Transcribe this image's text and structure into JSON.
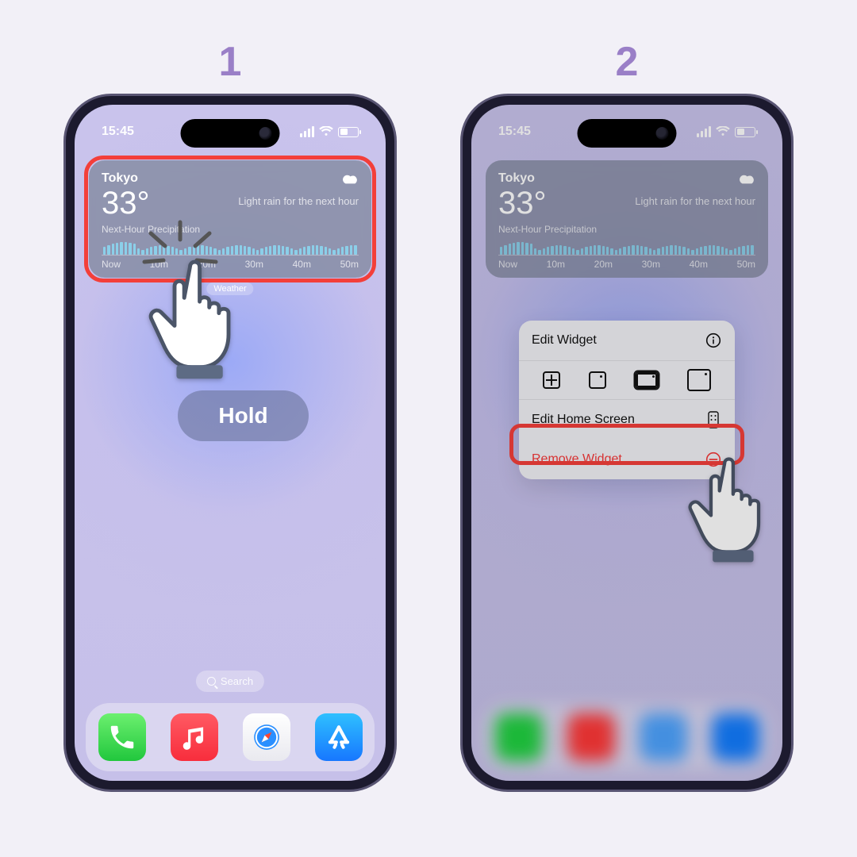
{
  "steps": {
    "one_label": "1",
    "two_label": "2"
  },
  "status": {
    "time": "15:45"
  },
  "widget": {
    "city": "Tokyo",
    "temperature": "33°",
    "condition": "Light rain for the next hour",
    "section_label": "Next-Hour Precipitation",
    "ticks": [
      "Now",
      "10m",
      "20m",
      "30m",
      "40m",
      "50m"
    ],
    "app_label": "Weather"
  },
  "annotations": {
    "hold_label": "Hold"
  },
  "homescreen": {
    "search_label": "Search",
    "dock_apps": [
      "Phone",
      "Music",
      "Safari",
      "App Store"
    ]
  },
  "context_menu": {
    "edit_widget_label": "Edit Widget",
    "edit_home_label": "Edit Home Screen",
    "remove_label": "Remove Widget"
  },
  "colors": {
    "highlight": "#f33f3a",
    "step_number": "#9a7fc7",
    "menu_destructive": "#f43838"
  }
}
